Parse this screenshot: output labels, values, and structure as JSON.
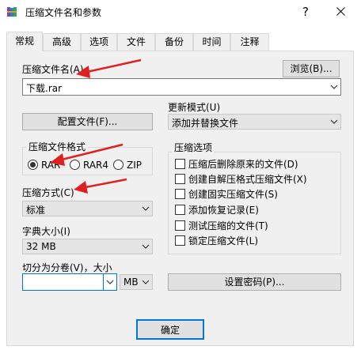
{
  "window": {
    "title": "压缩文件名和参数",
    "help_label": "?",
    "close_icon": "close-icon",
    "app_icon": "winrar-books-icon"
  },
  "tabs": [
    {
      "label": "常规",
      "active": true
    },
    {
      "label": "高级",
      "active": false
    },
    {
      "label": "选项",
      "active": false
    },
    {
      "label": "文件",
      "active": false
    },
    {
      "label": "备份",
      "active": false
    },
    {
      "label": "时间",
      "active": false
    },
    {
      "label": "注释",
      "active": false
    }
  ],
  "archive_name": {
    "label": "压缩文件名(A)",
    "browse_label": "浏览(B)...",
    "value": "下载.rar"
  },
  "profile_button": "配置文件(F)...",
  "update_mode": {
    "label": "更新模式(U)",
    "value": "添加并替换文件"
  },
  "archive_format": {
    "title": "压缩文件格式",
    "options": [
      {
        "label": "RAR",
        "checked": true
      },
      {
        "label": "RAR4",
        "checked": false
      },
      {
        "label": "ZIP",
        "checked": false
      }
    ]
  },
  "compression_method": {
    "label": "压缩方式(C)",
    "value": "标准"
  },
  "dictionary_size": {
    "label": "字典大小(I)",
    "value": "32 MB"
  },
  "split_volumes": {
    "label": "切分为分卷(V)，大小",
    "value": "",
    "unit": "MB"
  },
  "set_password_button": "设置密码(P)...",
  "archive_options": {
    "title": "压缩选项",
    "items": [
      {
        "label": "压缩后删除原来的文件(D)",
        "checked": false
      },
      {
        "label": "创建自解压格式压缩文件(X)",
        "checked": false
      },
      {
        "label": "创建固实压缩文件(S)",
        "checked": false
      },
      {
        "label": "添加恢复记录(E)",
        "checked": false
      },
      {
        "label": "测试压缩的文件(T)",
        "checked": false
      },
      {
        "label": "锁定压缩文件(L)",
        "checked": false
      }
    ]
  },
  "ok_button": "确定",
  "colors": {
    "annotation_arrow": "#e02020",
    "focus_border": "#0078d7"
  }
}
